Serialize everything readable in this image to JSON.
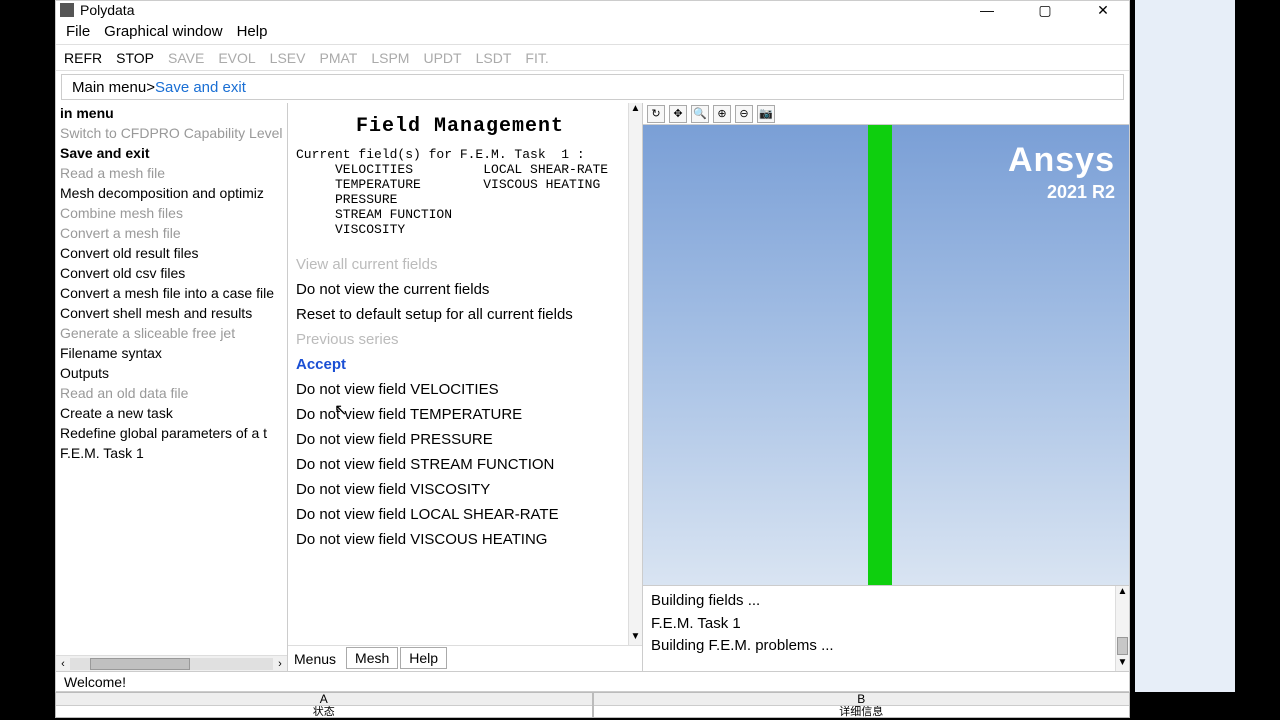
{
  "window": {
    "title": "Polydata",
    "min_label": "—",
    "max_label": "▢",
    "close_label": "✕"
  },
  "menubar": {
    "items": [
      "File",
      "Graphical window",
      "Help"
    ]
  },
  "toolbar": {
    "items": [
      {
        "label": "REFR",
        "disabled": false
      },
      {
        "label": "STOP",
        "disabled": false
      },
      {
        "label": "SAVE",
        "disabled": true
      },
      {
        "label": "EVOL",
        "disabled": true
      },
      {
        "label": "LSEV",
        "disabled": true
      },
      {
        "label": "PMAT",
        "disabled": true
      },
      {
        "label": "LSPM",
        "disabled": true
      },
      {
        "label": "UPDT",
        "disabled": true
      },
      {
        "label": "LSDT",
        "disabled": true
      },
      {
        "label": "FIT.",
        "disabled": true
      }
    ]
  },
  "breadcrumb": {
    "root": "Main menu",
    "sep": " > ",
    "current": "Save and exit"
  },
  "left_menu": {
    "items": [
      {
        "label": "in menu",
        "style": "bold"
      },
      {
        "label": "Switch to CFDPRO Capability Level",
        "style": "dim"
      },
      {
        "label": "Save and exit",
        "style": "bold"
      },
      {
        "label": "Read a mesh file",
        "style": "dim"
      },
      {
        "label": "Mesh decomposition and optimiz",
        "style": ""
      },
      {
        "label": "Combine mesh files",
        "style": "dim"
      },
      {
        "label": "Convert a mesh file",
        "style": "dim"
      },
      {
        "label": "Convert old result files",
        "style": ""
      },
      {
        "label": "Convert old csv files",
        "style": ""
      },
      {
        "label": "Convert a mesh file into a case file",
        "style": ""
      },
      {
        "label": "Convert shell mesh and results",
        "style": ""
      },
      {
        "label": "Generate a sliceable free jet",
        "style": "dim"
      },
      {
        "label": "Filename syntax",
        "style": ""
      },
      {
        "label": "Outputs",
        "style": ""
      },
      {
        "label": "Read an old data file",
        "style": "dim"
      },
      {
        "label": "Create a new task",
        "style": ""
      },
      {
        "label": "Redefine global parameters of a t",
        "style": ""
      },
      {
        "label": "F.E.M. Task  1",
        "style": ""
      }
    ],
    "harrow_left": "‹",
    "harrow_right": "›"
  },
  "center": {
    "title": "Field Management",
    "mono": "Current field(s) for F.E.M. Task  1 :\n     VELOCITIES         LOCAL SHEAR-RATE\n     TEMPERATURE        VISCOUS HEATING\n     PRESSURE\n     STREAM FUNCTION\n     VISCOSITY",
    "actions": [
      {
        "label": "View all current fields",
        "style": "dim"
      },
      {
        "label": "Do not view the current fields",
        "style": ""
      },
      {
        "label": "Reset to default setup for all current fields",
        "style": ""
      },
      {
        "label": "Previous series",
        "style": "dim"
      },
      {
        "label": "Accept",
        "style": "accept"
      },
      {
        "label": "Do not view field VELOCITIES",
        "style": ""
      },
      {
        "label": "Do not view field TEMPERATURE",
        "style": ""
      },
      {
        "label": "Do not view field PRESSURE",
        "style": ""
      },
      {
        "label": "Do not view field STREAM FUNCTION",
        "style": ""
      },
      {
        "label": "Do not view field VISCOSITY",
        "style": ""
      },
      {
        "label": "Do not view field LOCAL SHEAR-RATE",
        "style": ""
      },
      {
        "label": "Do not view field VISCOUS HEATING",
        "style": ""
      }
    ],
    "tabs": [
      "Menus",
      "Mesh",
      "Help"
    ],
    "sarrow_up": "▲",
    "sarrow_down": "▼"
  },
  "right": {
    "icons": [
      "↻",
      "✥",
      "🔍",
      "⊕",
      "⊖",
      "📷"
    ],
    "brand": {
      "name": "Ansys",
      "version": "2021 R2"
    },
    "log": [
      "   Building fields ...",
      "F.E.M. Task  1",
      "   Building F.E.M. problems ..."
    ],
    "sarrow_up": "▲",
    "sarrow_down": "▼"
  },
  "statusbar": {
    "text": "Welcome!"
  },
  "sheet": {
    "cols": [
      {
        "hdr": "A",
        "tab": "状态"
      },
      {
        "hdr": "B",
        "tab": "详细信息"
      }
    ]
  }
}
